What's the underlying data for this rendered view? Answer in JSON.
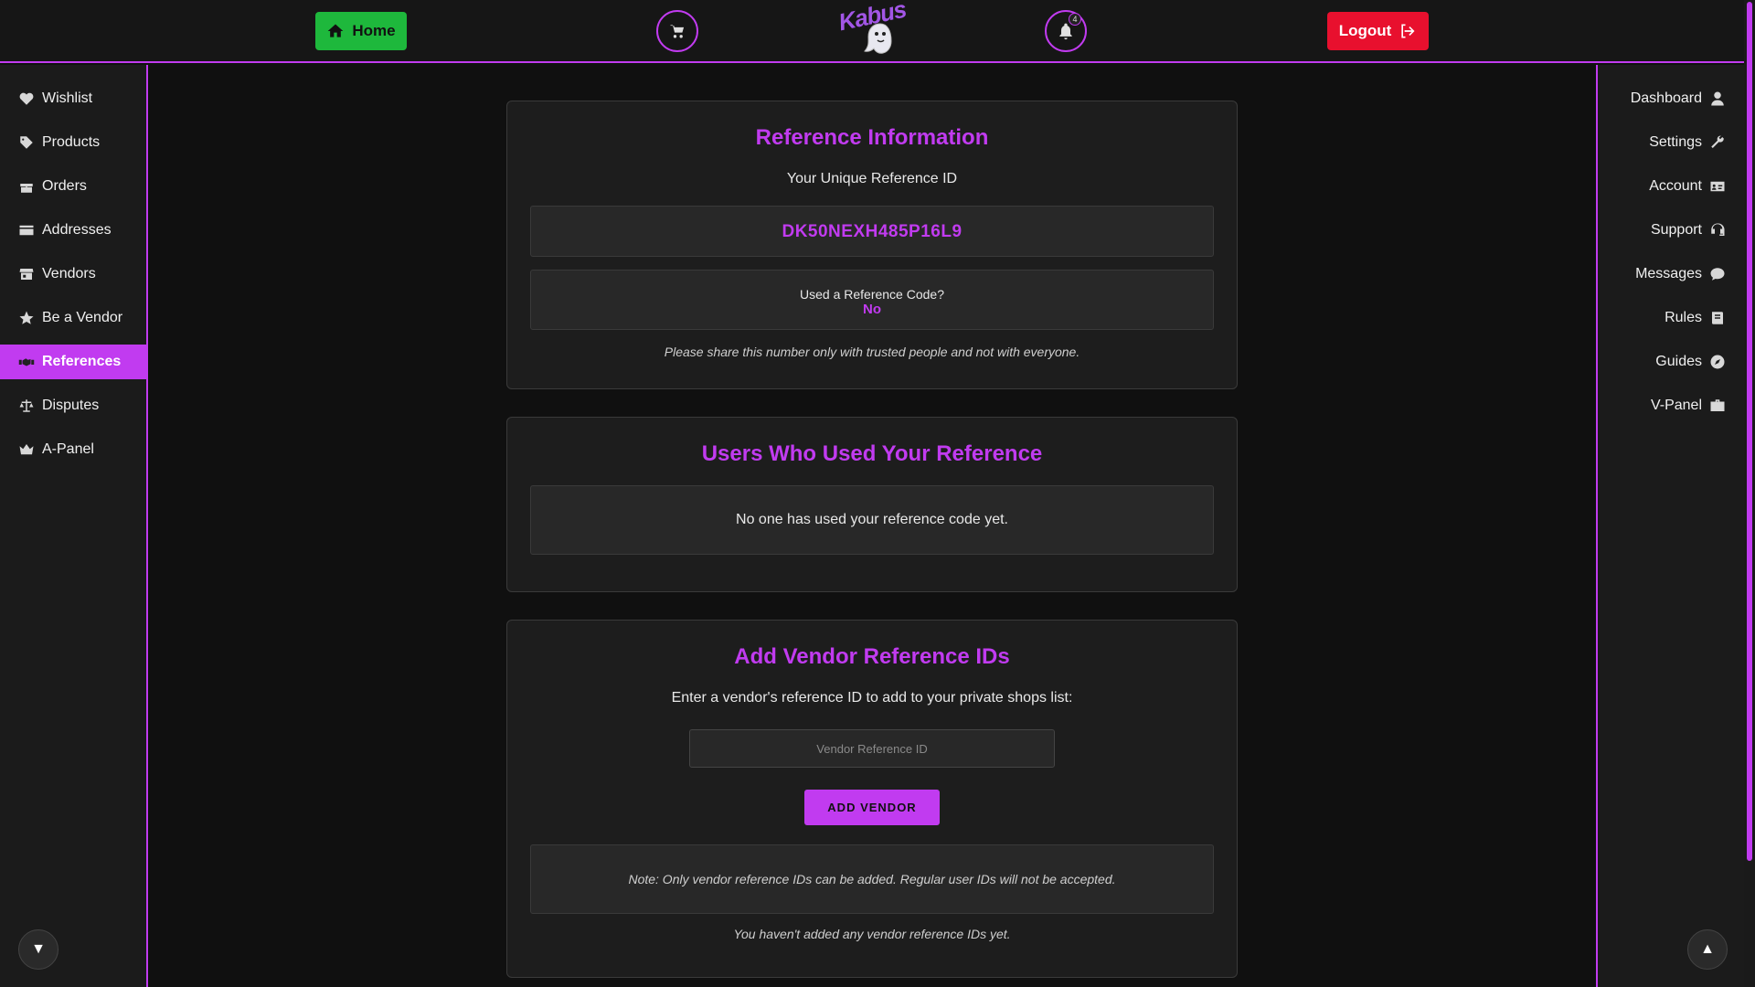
{
  "header": {
    "home_label": "Home",
    "logout_label": "Logout",
    "notification_count": "4",
    "logo_text": "Kabus"
  },
  "sidebar_left": {
    "items": [
      {
        "label": "Wishlist",
        "icon": "heart-icon"
      },
      {
        "label": "Products",
        "icon": "tag-icon"
      },
      {
        "label": "Orders",
        "icon": "gift-icon"
      },
      {
        "label": "Addresses",
        "icon": "credit-card-icon"
      },
      {
        "label": "Vendors",
        "icon": "store-icon"
      },
      {
        "label": "Be a Vendor",
        "icon": "star-icon"
      },
      {
        "label": "References",
        "icon": "handshake-icon",
        "active": true
      },
      {
        "label": "Disputes",
        "icon": "scale-icon"
      },
      {
        "label": "A-Panel",
        "icon": "crown-icon"
      }
    ],
    "scroll_down_glyph": "▼"
  },
  "sidebar_right": {
    "items": [
      {
        "label": "Dashboard",
        "icon": "user-icon"
      },
      {
        "label": "Settings",
        "icon": "wrench-icon"
      },
      {
        "label": "Account",
        "icon": "id-card-icon"
      },
      {
        "label": "Support",
        "icon": "headset-icon"
      },
      {
        "label": "Messages",
        "icon": "chat-icon"
      },
      {
        "label": "Rules",
        "icon": "book-icon"
      },
      {
        "label": "Guides",
        "icon": "compass-icon"
      },
      {
        "label": "V-Panel",
        "icon": "briefcase-icon"
      }
    ],
    "scroll_up_glyph": "▲"
  },
  "reference_info": {
    "title": "Reference Information",
    "subtitle": "Your Unique Reference ID",
    "reference_id": "DK50NEXH485P16L9",
    "used_code_label": "Used a Reference Code?",
    "used_code_value": "No",
    "share_note": "Please share this number only with trusted people and not with everyone."
  },
  "users_used": {
    "title": "Users Who Used Your Reference",
    "empty_message": "No one has used your reference code yet."
  },
  "add_vendor": {
    "title": "Add Vendor Reference IDs",
    "instruction": "Enter a vendor's reference ID to add to your private shops list:",
    "input_placeholder": "Vendor Reference ID",
    "button_label": "ADD VENDOR",
    "note": "Note: Only vendor reference IDs can be added. Regular user IDs will not be accepted.",
    "empty_message": "You haven't added any vendor reference IDs yet."
  },
  "colors": {
    "accent": "#c13bf0",
    "home_green": "#1eb83c",
    "logout_red": "#e8102e",
    "background": "#101010"
  }
}
